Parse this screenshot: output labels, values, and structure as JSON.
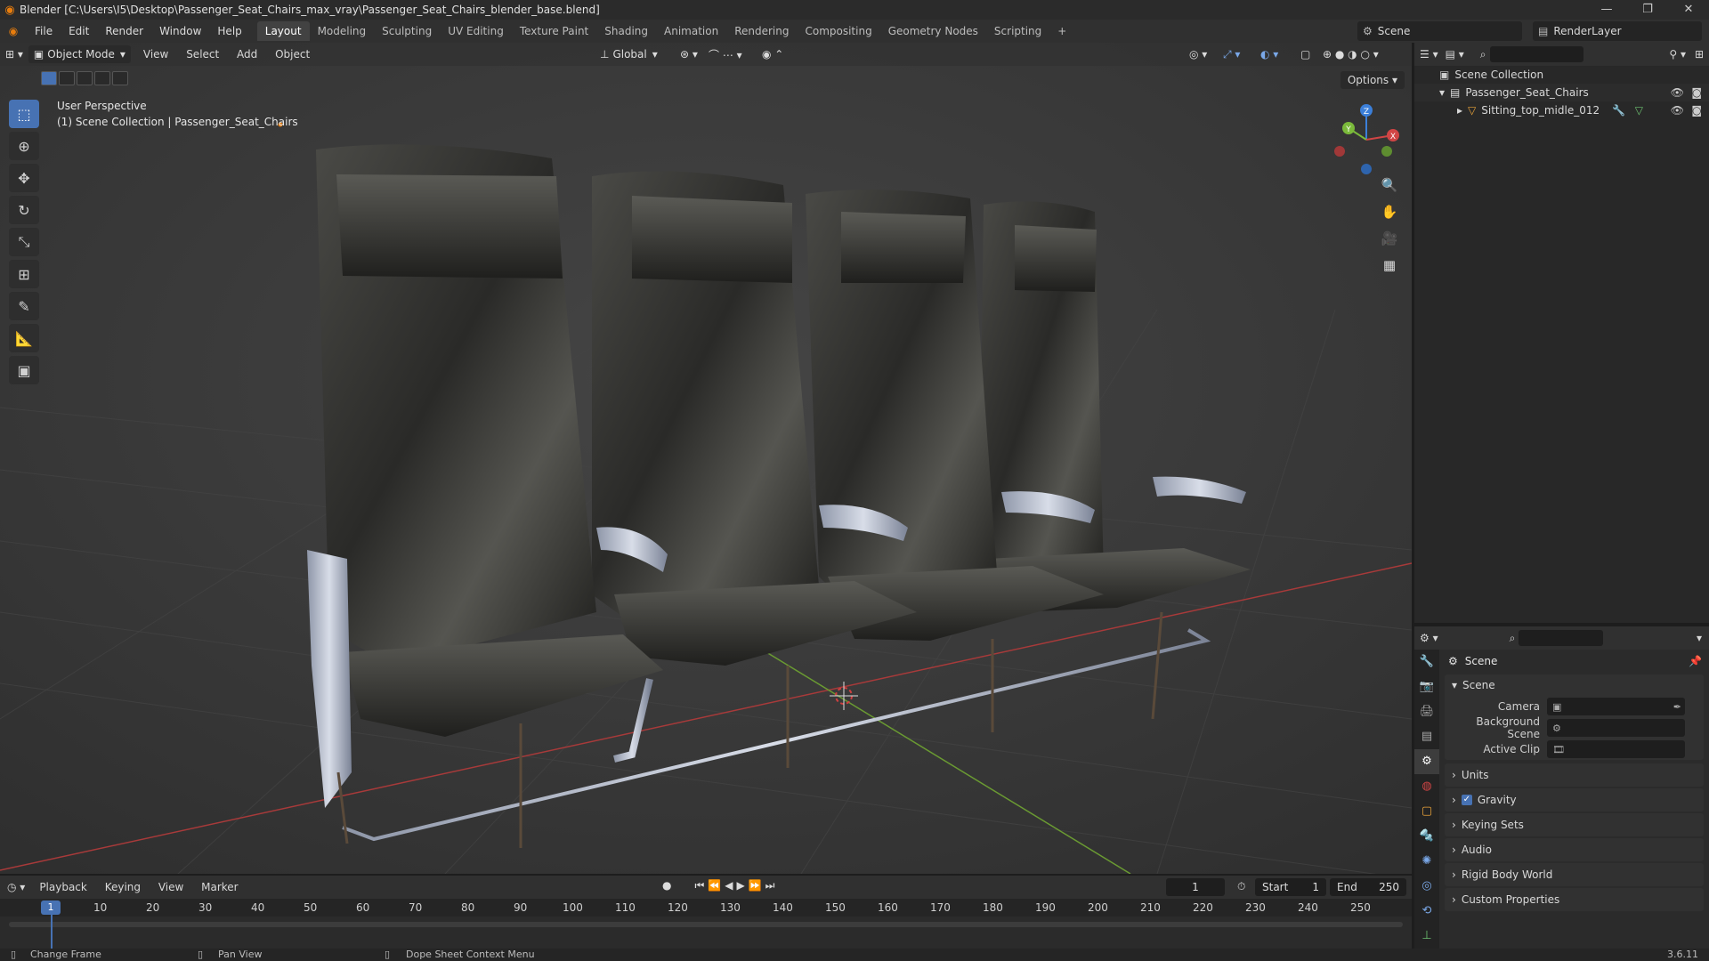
{
  "window": {
    "title": "Blender [C:\\Users\\I5\\Desktop\\Passenger_Seat_Chairs_max_vray\\Passenger_Seat_Chairs_blender_base.blend]",
    "controls": [
      "—",
      "❐",
      "✕"
    ]
  },
  "menu": [
    "File",
    "Edit",
    "Render",
    "Window",
    "Help"
  ],
  "workspaces": [
    "Layout",
    "Modeling",
    "Sculpting",
    "UV Editing",
    "Texture Paint",
    "Shading",
    "Animation",
    "Rendering",
    "Compositing",
    "Geometry Nodes",
    "Scripting",
    "+"
  ],
  "active_workspace": "Layout",
  "scene": {
    "name": "Scene",
    "render_layer": "RenderLayer"
  },
  "viewport": {
    "mode": "Object Mode",
    "menus": [
      "View",
      "Select",
      "Add",
      "Object"
    ],
    "orientation": "Global",
    "options_label": "Options",
    "info_line1": "User Perspective",
    "info_line2": "(1) Scene Collection | Passenger_Seat_Chairs",
    "gizmo_axes": [
      "Z",
      "Y",
      "X"
    ],
    "tools": [
      "select-box-icon",
      "cursor-icon",
      "move-icon",
      "rotate-icon",
      "scale-icon",
      "transform-icon",
      "annotate-icon",
      "measure-icon",
      "add-cube-icon"
    ]
  },
  "outliner": {
    "rows": [
      {
        "label": "Scene Collection",
        "indent": 0
      },
      {
        "label": "Passenger_Seat_Chairs",
        "indent": 1
      },
      {
        "label": "Sitting_top_midle_012",
        "indent": 2
      }
    ]
  },
  "properties": {
    "context": "Scene",
    "panel": "Scene",
    "fields": [
      {
        "label": "Camera",
        "value": ""
      },
      {
        "label": "Background Scene",
        "value": ""
      },
      {
        "label": "Active Clip",
        "value": ""
      }
    ],
    "subpanels": [
      "Units",
      "Gravity",
      "Keying Sets",
      "Audio",
      "Rigid Body World",
      "Custom Properties"
    ]
  },
  "timeline": {
    "menus": [
      "Playback",
      "Keying",
      "View",
      "Marker"
    ],
    "current_frame": "1",
    "start_label": "Start",
    "start": "1",
    "end_label": "End",
    "end": "250",
    "ruler": [
      "1",
      "10",
      "20",
      "30",
      "40",
      "50",
      "60",
      "70",
      "80",
      "90",
      "100",
      "110",
      "120",
      "130",
      "140",
      "150",
      "160",
      "170",
      "180",
      "190",
      "200",
      "210",
      "220",
      "230",
      "240",
      "250"
    ]
  },
  "status": {
    "left": "Change Frame",
    "mid": "Pan View",
    "right": "Dope Sheet Context Menu",
    "version": "3.6.11"
  },
  "colors": {
    "accent": "#4772b3",
    "orange": "#e87d0d",
    "x_axis": "#d04545",
    "y_axis": "#7ab93a",
    "z_axis": "#3b7fd9"
  }
}
